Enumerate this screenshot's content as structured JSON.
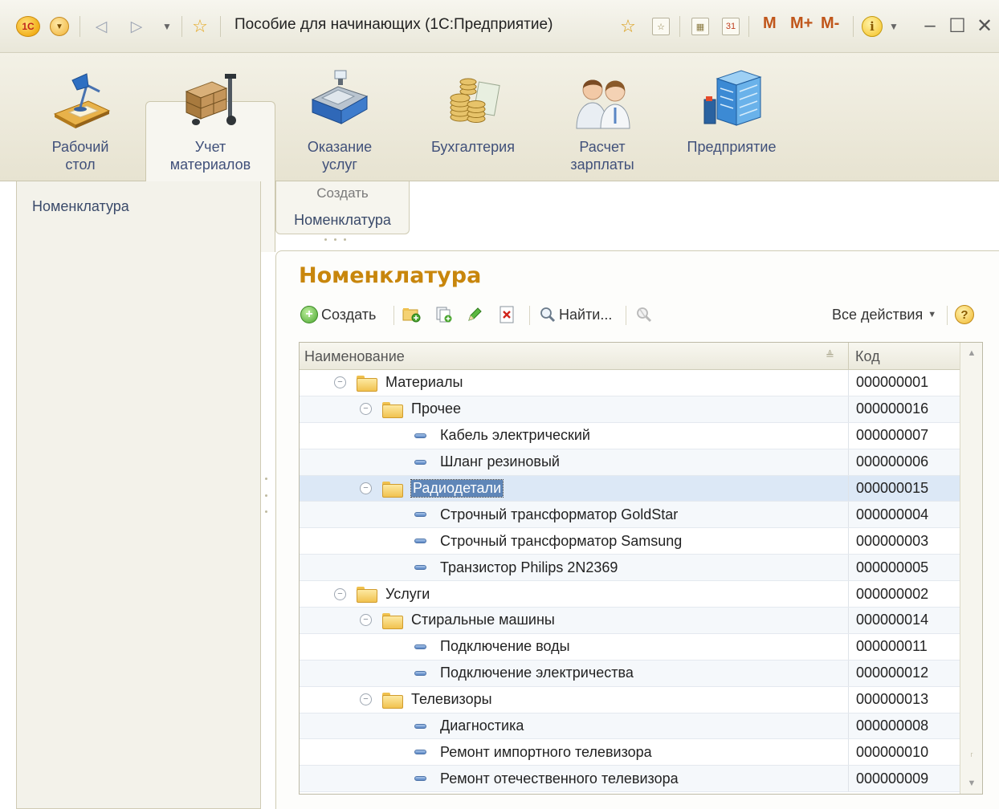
{
  "window": {
    "title": "Пособие для начинающих  (1С:Предприятие)",
    "logo_text": "1С",
    "m_buttons": [
      "M",
      "M+",
      "M-"
    ],
    "minimize": "–",
    "maximize": "☐",
    "close": "✕"
  },
  "sections": [
    {
      "label": "Рабочий\nстол",
      "icon": "desk-lamp-icon",
      "active": false
    },
    {
      "label": "Учет\nматериалов",
      "icon": "pallet-truck-icon",
      "active": true
    },
    {
      "label": "Оказание\nуслуг",
      "icon": "cash-register-icon",
      "active": false
    },
    {
      "label": "Бухгалтерия",
      "icon": "coins-icon",
      "active": false
    },
    {
      "label": "Расчет\nзарплаты",
      "icon": "people-icon",
      "active": false
    },
    {
      "label": "Предприятие",
      "icon": "building-icon",
      "active": false
    }
  ],
  "nav": {
    "items": [
      "Номенклатура"
    ]
  },
  "actions": {
    "header": "Создать",
    "items": [
      "Номенклатура"
    ]
  },
  "form": {
    "title": "Номенклатура",
    "toolbar": {
      "create_label": "Создать",
      "find_label": "Найти...",
      "all_actions_label": "Все действия",
      "help_label": "?"
    },
    "table": {
      "columns": [
        "Наименование",
        "Код"
      ],
      "rows": [
        {
          "level": 1,
          "kind": "group",
          "name": "Материалы",
          "code": "000000001",
          "selected": false
        },
        {
          "level": 2,
          "kind": "group",
          "name": "Прочее",
          "code": "000000016",
          "selected": false
        },
        {
          "level": 3,
          "kind": "item",
          "name": "Кабель электрический",
          "code": "000000007",
          "selected": false
        },
        {
          "level": 3,
          "kind": "item",
          "name": "Шланг резиновый",
          "code": "000000006",
          "selected": false
        },
        {
          "level": 2,
          "kind": "group",
          "name": "Радиодетали",
          "code": "000000015",
          "selected": true
        },
        {
          "level": 3,
          "kind": "item",
          "name": "Строчный трансформатор GoldStar",
          "code": "000000004",
          "selected": false
        },
        {
          "level": 3,
          "kind": "item",
          "name": "Строчный трансформатор Samsung",
          "code": "000000003",
          "selected": false
        },
        {
          "level": 3,
          "kind": "item",
          "name": "Транзистор Philips 2N2369",
          "code": "000000005",
          "selected": false
        },
        {
          "level": 1,
          "kind": "group",
          "name": "Услуги",
          "code": "000000002",
          "selected": false
        },
        {
          "level": 2,
          "kind": "group",
          "name": "Стиральные машины",
          "code": "000000014",
          "selected": false
        },
        {
          "level": 3,
          "kind": "item",
          "name": "Подключение воды",
          "code": "000000011",
          "selected": false
        },
        {
          "level": 3,
          "kind": "item",
          "name": "Подключение электричества",
          "code": "000000012",
          "selected": false
        },
        {
          "level": 2,
          "kind": "group",
          "name": "Телевизоры",
          "code": "000000013",
          "selected": false
        },
        {
          "level": 3,
          "kind": "item",
          "name": "Диагностика",
          "code": "000000008",
          "selected": false
        },
        {
          "level": 3,
          "kind": "item",
          "name": "Ремонт импортного телевизора",
          "code": "000000010",
          "selected": false
        },
        {
          "level": 3,
          "kind": "item",
          "name": "Ремонт отечественного телевизора",
          "code": "000000009",
          "selected": false
        }
      ]
    }
  },
  "colors": {
    "accent_title": "#c8860c",
    "selection": "#5f86b8",
    "row_selected": "#dce8f6"
  }
}
